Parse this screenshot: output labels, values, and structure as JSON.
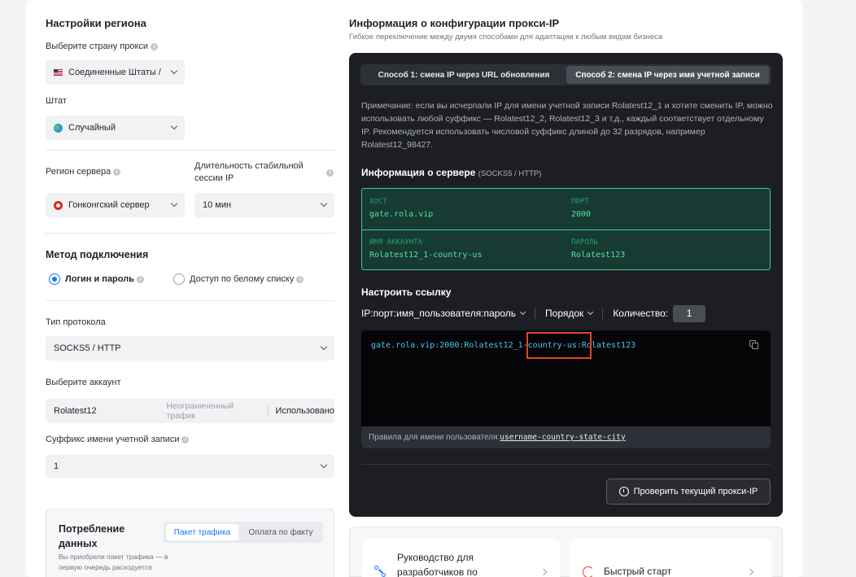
{
  "region": {
    "title": "Настройки региона",
    "country_label": "Выберите страну прокси",
    "country_value": "Соединенные Штаты /",
    "state_label": "Штат",
    "state_value": "Случайный",
    "server_region_label": "Регион сервера",
    "server_region_value": "Гонконгский сервер",
    "session_label": "Длительность стабильной сессии IP",
    "session_value": "10 мин"
  },
  "connection": {
    "title": "Метод подключения",
    "option_login": "Логин и пароль",
    "option_whitelist": "Доступ по белому списку",
    "protocol_label": "Тип протокола",
    "protocol_value": "SOCKS5 / HTTP",
    "account_label": "Выберите аккаунт",
    "account_name": "Rolatest12",
    "account_traffic": "Неограниченный трафик",
    "account_used": "Использовано",
    "suffix_label": "Суффикс имени учетной записи",
    "suffix_value": "1"
  },
  "consumption": {
    "title": "Потребление данных",
    "tab_package": "Пакет трафика",
    "tab_payg": "Оплата по факту",
    "desc": "Вы приобрели пакет трафика — в первую очередь расходуется"
  },
  "config": {
    "title": "Информация о конфигурации прокси-IP",
    "subtitle": "Гибкое переключение между двумя способами для адаптации к любым видам бизнеса",
    "tab1": "Способ 1: смена IP через URL обновления",
    "tab2": "Способ 2: смена IP через имя учетной записи",
    "note": "Примечание: если вы исчерпали IP для имени учетной записи Rolatest12_1 и хотите сменить IP, можно использовать любой суффикс — Rolatest12_2, Rolatest12_3 и т.д., каждый соответствует отдельному IP. Рекомендуется использовать числовой суффикс длиной до 32 разрядов, например Rolatest12_98427.",
    "server_title": "Информация о сервере",
    "server_proto": "(SOCKS5 / HTTP)",
    "host_label": "ХОСТ",
    "host_value": "gate.rola.vip",
    "port_label": "ПОРТ",
    "port_value": "2000",
    "account_label": "ИМЯ АККАУНТА",
    "account_value": "Rolatest12_1-country-us",
    "password_label": "ПАРОЛЬ",
    "password_value": "Rolatest123",
    "link_title": "Настроить ссылку",
    "link_format": "IP:порт:имя_пользователя:пароль",
    "order_label": "Порядок",
    "quantity_label": "Количество:",
    "quantity_value": "1",
    "code_part1": "gate.rola.vip:2000:Rolatest12_1",
    "code_part2": "-country-us",
    "code_part3": ":Rolatest123",
    "rules_label": "Правила для имени пользователя:",
    "rules_value": "username-country-state-city",
    "check_button": "Проверить текущий прокси-IP"
  },
  "bottom": {
    "dev_guide": "Руководство для разработчиков по",
    "quick_start": "Быстрый старт"
  },
  "colors": {
    "accent": "#1677ff",
    "dark_panel": "#1c1e23",
    "server_green": "#52e3a1",
    "code_cyan": "#4fc3f7",
    "highlight_red": "#e0452c"
  }
}
